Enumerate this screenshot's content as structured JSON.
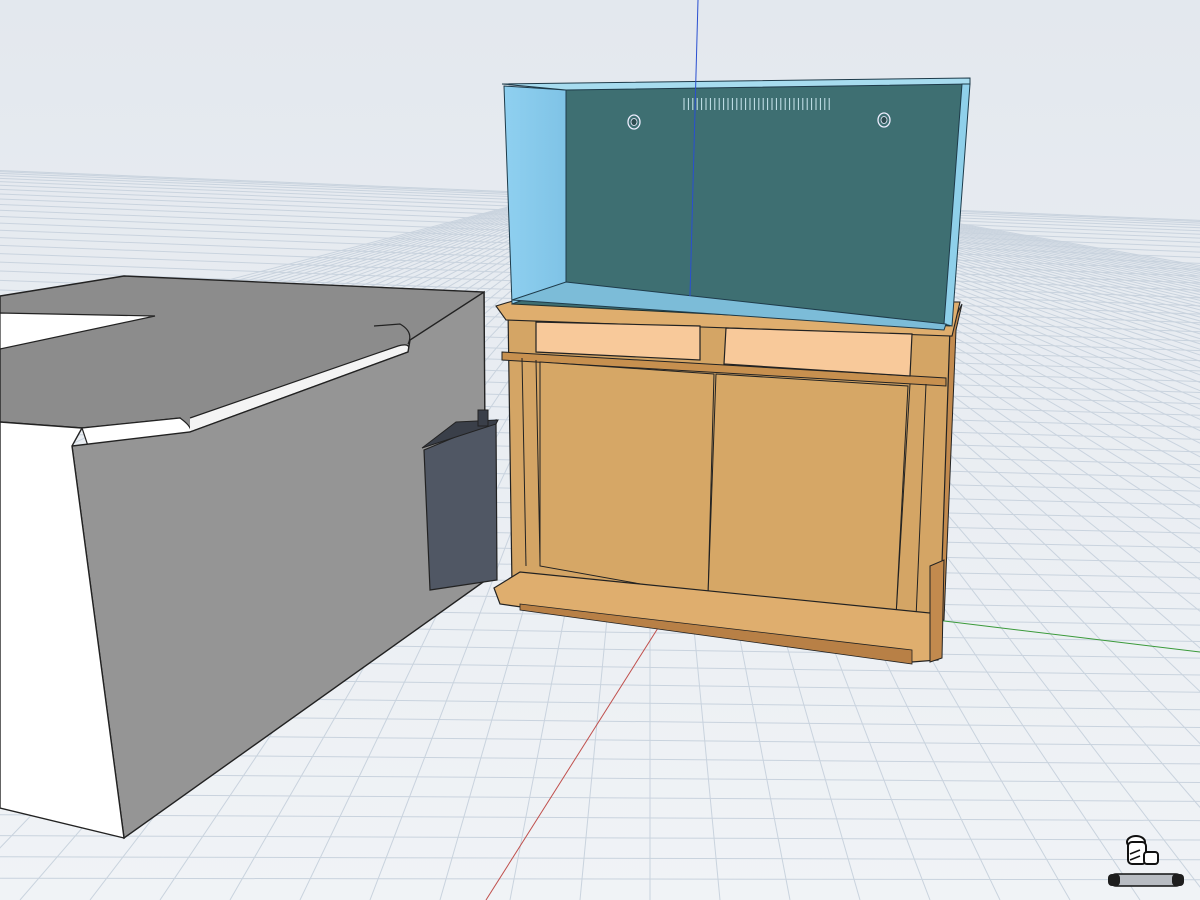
{
  "app": {
    "view_mode": "3D perspective",
    "ground_grid": true
  },
  "colors": {
    "background_top": "#e6eaf0",
    "background_bottom": "#eef1f5",
    "grid_line": "#c9d3de",
    "axis_x": "#c0504d",
    "axis_y": "#3a9a3a",
    "axis_z": "#2a4fd0",
    "desk_top": "#8a8a8a",
    "desk_side": "#959595",
    "desk_white": "#ffffff",
    "sump_box": "#4e5562",
    "cabinet_wood": "#d4a565",
    "cabinet_wood_dark": "#c28a4e",
    "cabinet_trim": "#e8b87a",
    "cabinet_drawer": "#f8c99a",
    "tank_water": "#3f6f72",
    "tank_glass_side": "#86c5e6",
    "tank_glass_edge": "#9fd8ee"
  },
  "scene": {
    "objects": [
      {
        "name": "desk",
        "type": "L-shaped desk"
      },
      {
        "name": "sump-box",
        "type": "dark box"
      },
      {
        "name": "cabinet-stand",
        "type": "wooden cabinet with two doors and two drawers"
      },
      {
        "name": "aquarium-tank",
        "type": "glass tank"
      }
    ]
  },
  "nav_widget": {
    "icon": "navigation-cube-icon"
  }
}
